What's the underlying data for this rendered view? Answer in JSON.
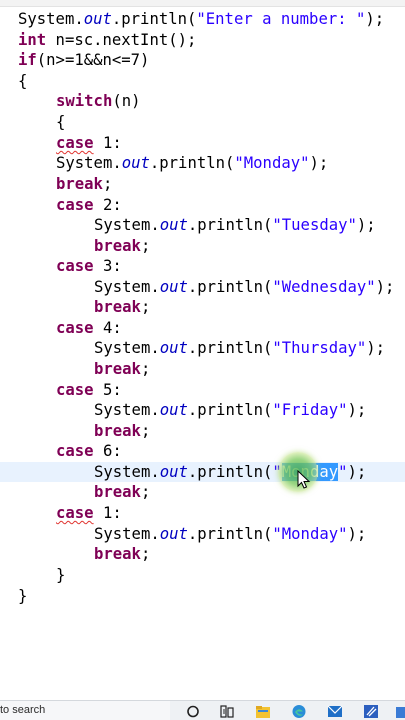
{
  "code": {
    "line1": [
      "System.",
      "out",
      ".println(",
      "\"Enter a number: \"",
      ");"
    ],
    "line2": [
      "int",
      " n=sc.nextInt();"
    ],
    "line3": [
      "if",
      "(n>=1&&n<=7)"
    ],
    "line4": "{",
    "line5": [
      "switch",
      "(n)"
    ],
    "line6": "{",
    "case_kw": "case",
    "break_kw": "break",
    "semicolon": ";",
    "sys": "System.",
    "out": "out",
    "println": ".println(",
    "close": ");",
    "cases": [
      {
        "label": " 1:",
        "text": "\"Monday\""
      },
      {
        "label": " 2:",
        "text": "\"Tuesday\""
      },
      {
        "label": " 3:",
        "text": "\"Wednesday\""
      },
      {
        "label": " 4:",
        "text": "\"Thursday\""
      },
      {
        "label": " 5:",
        "text": "\"Friday\""
      },
      {
        "label": " 6:",
        "text_open": "\"",
        "text_selected": "Monday",
        "text_close": "\""
      },
      {
        "label": " 1:",
        "text": "\"Monday\""
      }
    ],
    "close_switch": "}",
    "close_if": "}"
  },
  "taskbar": {
    "search_placeholder": "to search",
    "icons": [
      "cortana-icon",
      "task-view-icon",
      "file-explorer-icon",
      "edge-icon",
      "mail-icon",
      "eclipse-icon",
      "store-icon"
    ]
  },
  "colors": {
    "keyword": "#7f0055",
    "field": "#0000c0",
    "string": "#2a00ff",
    "selection": "#3399ff",
    "current_line": "#e8f2fe",
    "error_underline": "#e0332f"
  }
}
